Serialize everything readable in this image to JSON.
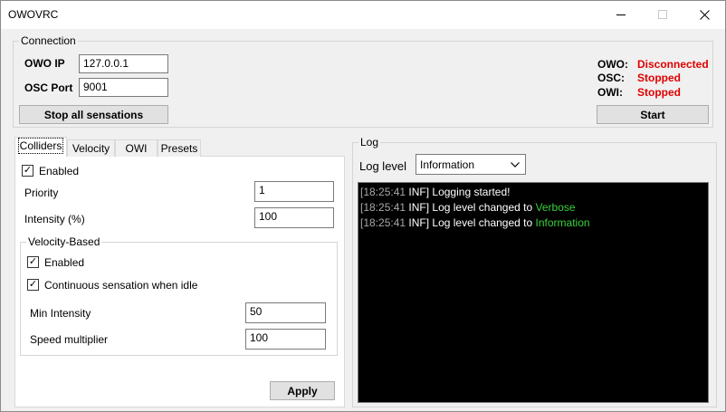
{
  "window": {
    "title": "OWOVRC"
  },
  "connection": {
    "legend": "Connection",
    "owo_ip_label": "OWO IP",
    "owo_ip_value": "127.0.0.1",
    "osc_port_label": "OSC Port",
    "osc_port_value": "9001",
    "stop_button": "Stop all sensations",
    "status": [
      {
        "label": "OWO:",
        "value": "Disconnected"
      },
      {
        "label": "OSC:",
        "value": "Stopped"
      },
      {
        "label": "OWI:",
        "value": "Stopped"
      }
    ],
    "start_button": "Start",
    "status_color": "#e00000"
  },
  "tabs": [
    "Colliders",
    "Velocity",
    "OWI",
    "Presets"
  ],
  "colliders": {
    "enabled_label": "Enabled",
    "enabled_checked": "✓",
    "priority_label": "Priority",
    "priority_value": "1",
    "intensity_label": "Intensity (%)",
    "intensity_value": "100",
    "velocity_group": {
      "legend": "Velocity-Based",
      "enabled_label": "Enabled",
      "enabled_checked": "✓",
      "continuous_label": "Continuous sensation when idle",
      "continuous_checked": "✓",
      "min_intensity_label": "Min Intensity",
      "min_intensity_value": "50",
      "speed_label": "Speed multiplier",
      "speed_value": "100"
    },
    "apply_button": "Apply"
  },
  "log": {
    "legend": "Log",
    "level_label": "Log level",
    "level_value": "Information",
    "lines": [
      {
        "ts": "[18:25:41",
        "lv": "INF]",
        "msg": "Logging started!",
        "hl": ""
      },
      {
        "ts": "[18:25:41",
        "lv": "INF]",
        "msg": "Log level changed to",
        "hl": "Verbose"
      },
      {
        "ts": "[18:25:41",
        "lv": "INF]",
        "msg": "Log level changed to",
        "hl": "Information"
      }
    ],
    "highlight_color": "#3ad13a"
  }
}
